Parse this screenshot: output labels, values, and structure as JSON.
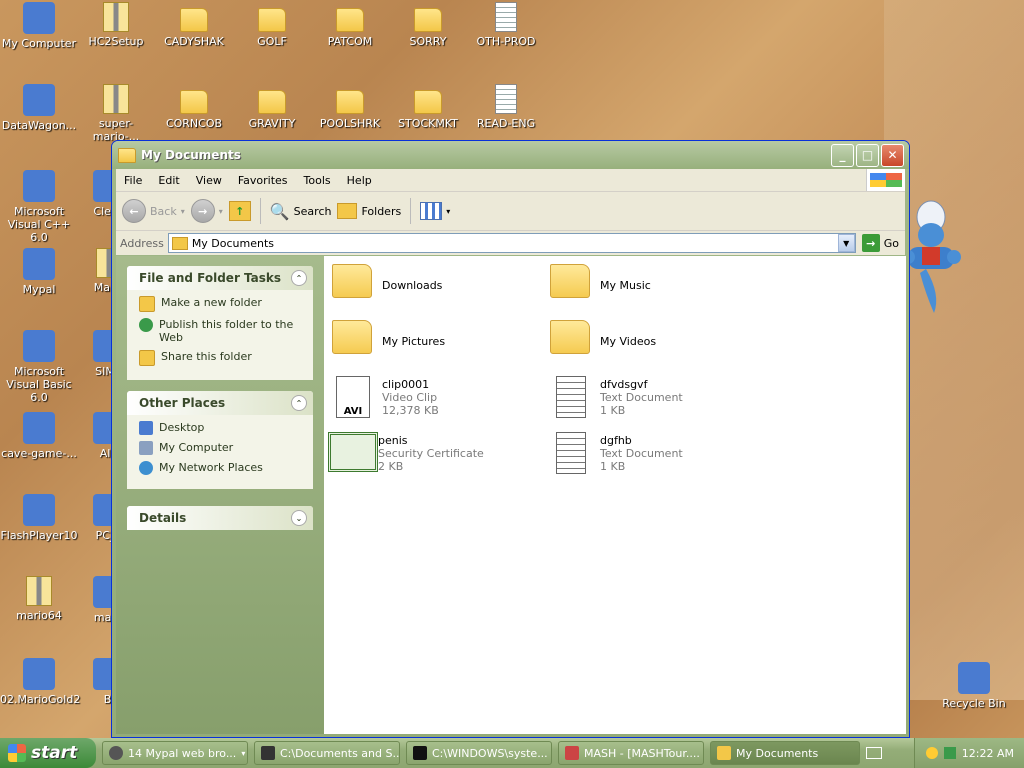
{
  "desktop": {
    "icons": [
      {
        "label": "My Computer",
        "kind": "generic"
      },
      {
        "label": "HC2Setup",
        "kind": "zip"
      },
      {
        "label": "CADYSHAK",
        "kind": "folder"
      },
      {
        "label": "GOLF",
        "kind": "folder"
      },
      {
        "label": "PATCOM",
        "kind": "folder"
      },
      {
        "label": "SORRY",
        "kind": "folder"
      },
      {
        "label": "OTH-PROD",
        "kind": "doc"
      },
      {
        "label": "DataWagon...",
        "kind": "generic"
      },
      {
        "label": "super-mario-...",
        "kind": "zip"
      },
      {
        "label": "CORNCOB",
        "kind": "folder"
      },
      {
        "label": "GRAVITY",
        "kind": "folder"
      },
      {
        "label": "POOLSHRK",
        "kind": "folder"
      },
      {
        "label": "STOCKMKT",
        "kind": "folder"
      },
      {
        "label": "READ-ENG",
        "kind": "doc"
      },
      {
        "label": "Microsoft Visual C++ 6.0",
        "kind": "generic"
      },
      {
        "label": "Clean",
        "kind": "generic"
      },
      {
        "label": "Mypal",
        "kind": "generic"
      },
      {
        "label": "Mario",
        "kind": "zip"
      },
      {
        "label": "Microsoft Visual Basic 6.0",
        "kind": "generic"
      },
      {
        "label": "SIMU",
        "kind": "generic"
      },
      {
        "label": "cave-game-...",
        "kind": "generic"
      },
      {
        "label": "AIR",
        "kind": "generic"
      },
      {
        "label": "FlashPlayer10",
        "kind": "generic"
      },
      {
        "label": "PC_S",
        "kind": "generic"
      },
      {
        "label": "mario64",
        "kind": "zip"
      },
      {
        "label": "mash",
        "kind": "generic"
      },
      {
        "label": "02.MarioGold2",
        "kind": "generic"
      },
      {
        "label": "Bl",
        "kind": "generic"
      },
      {
        "label": "Recycle Bin",
        "kind": "generic"
      }
    ]
  },
  "window": {
    "title": "My Documents",
    "menu": [
      "File",
      "Edit",
      "View",
      "Favorites",
      "Tools",
      "Help"
    ],
    "toolbar": {
      "back": "Back",
      "search": "Search",
      "folders": "Folders"
    },
    "address": {
      "label": "Address",
      "value": "My Documents",
      "go": "Go"
    },
    "tasks": {
      "title": "File and Folder Tasks",
      "items": [
        "Make a new folder",
        "Publish this folder to the Web",
        "Share this folder"
      ]
    },
    "places": {
      "title": "Other Places",
      "items": [
        "Desktop",
        "My Computer",
        "My Network Places"
      ]
    },
    "details": {
      "title": "Details"
    },
    "files": [
      {
        "name": "Downloads",
        "type": "",
        "size": "",
        "kind": "folder"
      },
      {
        "name": "My Music",
        "type": "",
        "size": "",
        "kind": "folder"
      },
      {
        "name": "My Pictures",
        "type": "",
        "size": "",
        "kind": "folder"
      },
      {
        "name": "My Videos",
        "type": "",
        "size": "",
        "kind": "folder"
      },
      {
        "name": "clip0001",
        "type": "Video Clip",
        "size": "12,378 KB",
        "kind": "avi"
      },
      {
        "name": "dfvdsgvf",
        "type": "Text Document",
        "size": "1 KB",
        "kind": "doc"
      },
      {
        "name": "penis",
        "type": "Security Certificate",
        "size": "2 KB",
        "kind": "cert"
      },
      {
        "name": "dgfhb",
        "type": "Text Document",
        "size": "1 KB",
        "kind": "doc"
      }
    ]
  },
  "taskbar": {
    "start": "start",
    "buttons": [
      "14 Mypal web bro...",
      "C:\\Documents and S...",
      "C:\\WINDOWS\\syste...",
      "MASH - [MASHTour....",
      "My Documents"
    ],
    "clock": "12:22 AM"
  }
}
